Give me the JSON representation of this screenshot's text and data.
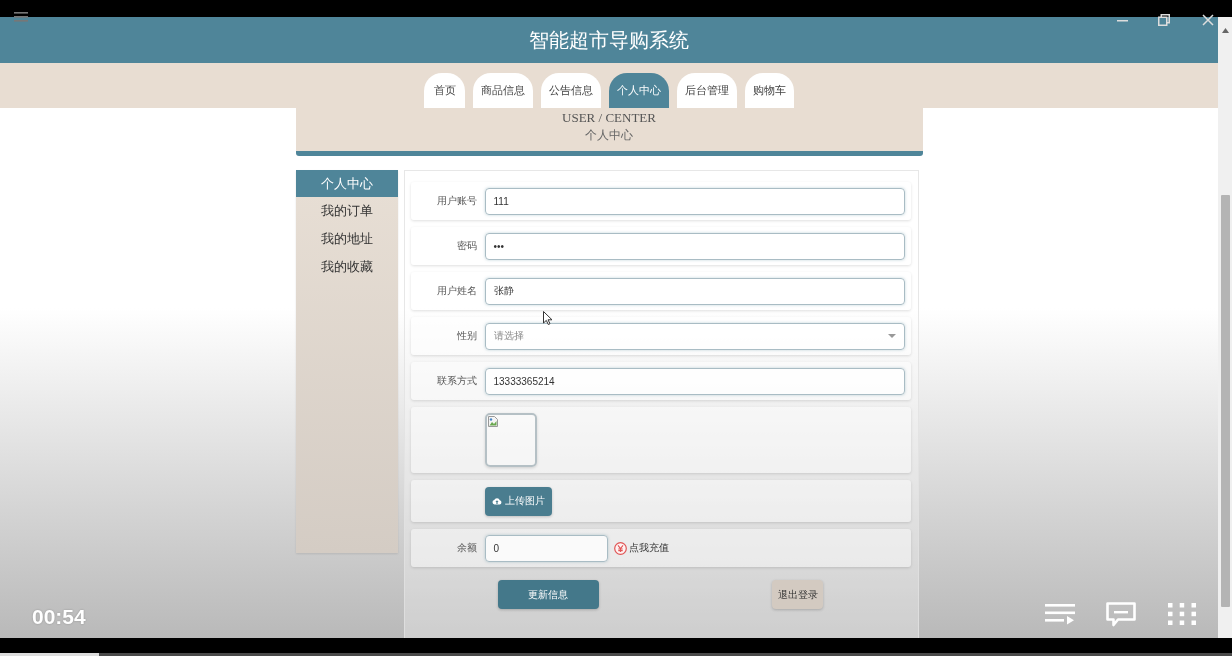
{
  "header": {
    "title": "智能超市导购系统"
  },
  "nav_tabs": [
    {
      "label": "首页",
      "selected": false
    },
    {
      "label": "商品信息",
      "selected": false
    },
    {
      "label": "公告信息",
      "selected": false
    },
    {
      "label": "个人中心",
      "selected": true
    },
    {
      "label": "后台管理",
      "selected": false
    },
    {
      "label": "购物车",
      "selected": false
    }
  ],
  "page_heading": {
    "subtitle": "USER / CENTER",
    "title": "个人中心"
  },
  "sidebar": {
    "items": [
      {
        "label": "个人中心",
        "selected": true
      },
      {
        "label": "我的订单",
        "selected": false
      },
      {
        "label": "我的地址",
        "selected": false
      },
      {
        "label": "我的收藏",
        "selected": false
      }
    ]
  },
  "form": {
    "fields": [
      {
        "kind": "text",
        "label": "用户账号",
        "value": "111"
      },
      {
        "kind": "text",
        "label": "密码",
        "value": "•••"
      },
      {
        "kind": "text",
        "label": "用户姓名",
        "value": "张静"
      },
      {
        "kind": "select",
        "label": "性别",
        "placeholder": "请选择"
      },
      {
        "kind": "text",
        "label": "联系方式",
        "value": "13333365214"
      },
      {
        "kind": "image"
      },
      {
        "kind": "upload",
        "button": "上传图片"
      },
      {
        "kind": "balance",
        "label": "余额",
        "value": "0",
        "link": "点我充值"
      }
    ],
    "buttons": [
      {
        "kind": "primary",
        "label": "更新信息"
      },
      {
        "kind": "secondary",
        "label": "退出登录"
      }
    ]
  },
  "video_player": {
    "time": "00:54",
    "progress": {
      "level": 0.08
    }
  }
}
